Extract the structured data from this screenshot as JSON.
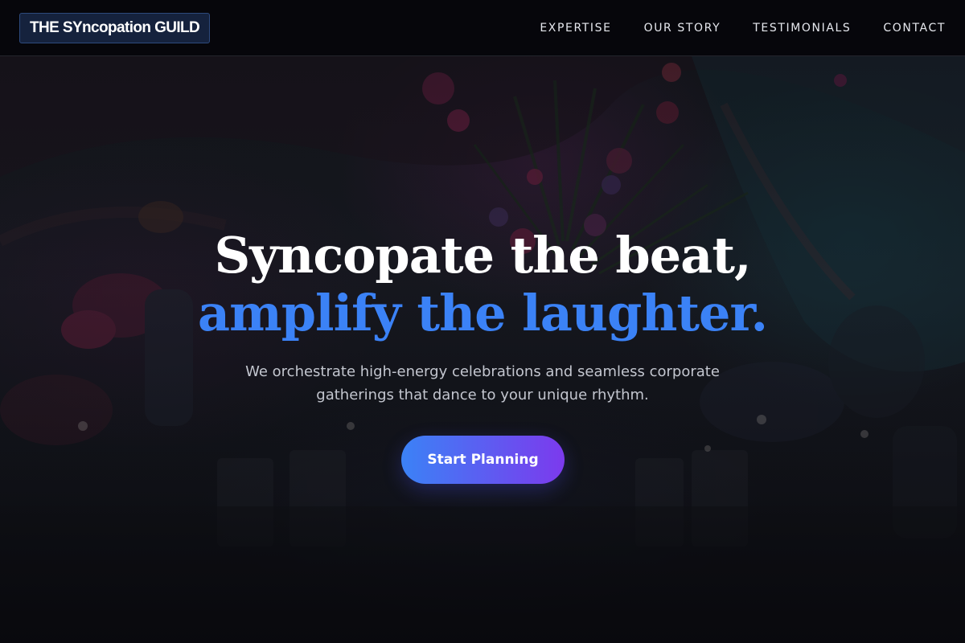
{
  "header": {
    "logo_text": "THE SYncopation GUILD",
    "nav": [
      {
        "label": "EXPERTISE"
      },
      {
        "label": "OUR STORY"
      },
      {
        "label": "TESTIMONIALS"
      },
      {
        "label": "CONTACT"
      }
    ]
  },
  "hero": {
    "headline_line1": "Syncopate the beat,",
    "headline_line2": "amplify the laughter.",
    "subtitle": "We orchestrate high-energy celebrations and seamless corporate gatherings that dance to your unique rhythm.",
    "cta_label": "Start Planning"
  },
  "colors": {
    "accent_blue": "#3b82f6",
    "accent_purple": "#7c3aed",
    "header_bg": "#06070b",
    "logo_bg": "#15223d"
  }
}
